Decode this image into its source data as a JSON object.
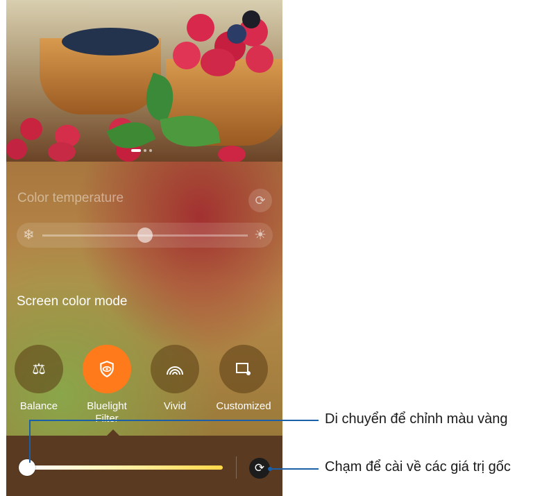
{
  "color_temperature": {
    "label": "Color temperature",
    "cold_icon": "snowflake-icon",
    "warm_icon": "sun-icon",
    "value": 0.5
  },
  "screen_color_mode": {
    "label": "Screen color mode",
    "modes": [
      {
        "label": "Balance",
        "icon": "scale-icon",
        "selected": false
      },
      {
        "label": "Bluelight Filter",
        "icon": "eye-shield-icon",
        "selected": true
      },
      {
        "label": "Vivid",
        "icon": "rainbow-icon",
        "selected": false
      },
      {
        "label": "Customized",
        "icon": "settings-screen-icon",
        "selected": false
      }
    ]
  },
  "bluelight_filter": {
    "level": 0.0,
    "reset_icon": "refresh-icon"
  },
  "callouts": {
    "slider": "Di chuyển để chỉnh màu vàng",
    "reset": "Chạm để cài về các giá trị gốc"
  },
  "colors": {
    "accent": "#ff7a1a",
    "callout_line": "#1a5fa8"
  }
}
